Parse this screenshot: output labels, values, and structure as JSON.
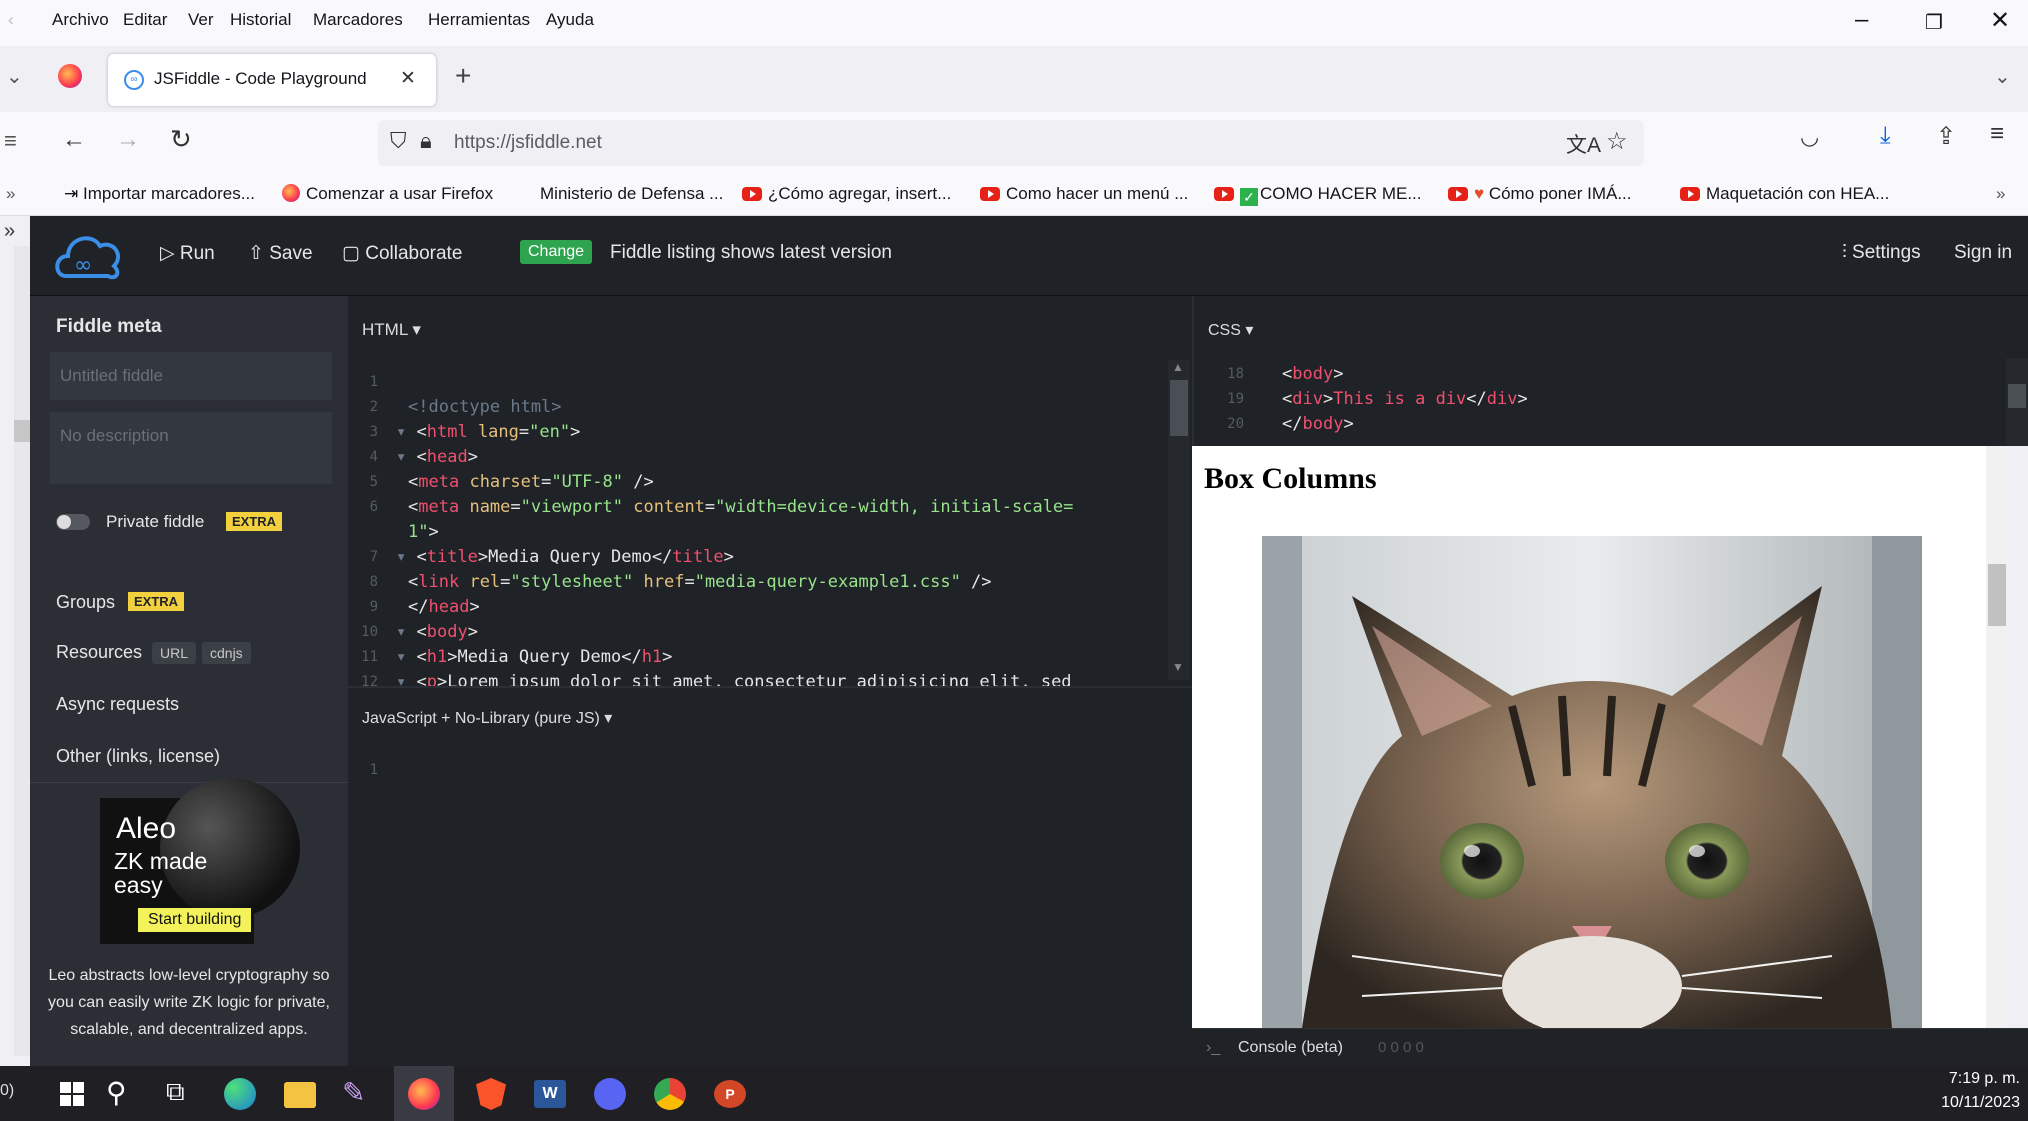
{
  "menubar": {
    "items": [
      "Archivo",
      "Editar",
      "Ver",
      "Historial",
      "Marcadores",
      "Herramientas",
      "Ayuda"
    ]
  },
  "tabs": [
    {
      "label": "JSFiddle - Code Playground"
    }
  ],
  "nav": {
    "url": "https://jsfiddle.net"
  },
  "bookmarks": [
    {
      "label": "Importar marcadores...",
      "icon": "import-icon"
    },
    {
      "label": "Comenzar a usar Firefox",
      "icon": "firefox-icon"
    },
    {
      "label": "Ministerio de Defensa ...",
      "icon": "blank"
    },
    {
      "label": "¿Cómo agregar, insert...",
      "icon": "youtube-icon"
    },
    {
      "label": "Como hacer un menú ...",
      "icon": "youtube-icon"
    },
    {
      "label": "COMO HACER ME...",
      "icon": "youtube-icon"
    },
    {
      "label": "Cómo poner IMÁ...",
      "icon": "youtube-icon"
    },
    {
      "label": "Maquetación con HEA...",
      "icon": "youtube-icon"
    }
  ],
  "jsfiddle": {
    "run": "Run",
    "save": "Save",
    "collaborate": "Collaborate",
    "change_badge": "Change",
    "notice": "Fiddle listing shows latest version",
    "settings": "Settings",
    "signin": "Sign in"
  },
  "meta": {
    "title": "Fiddle meta",
    "name_placeholder": "Untitled fiddle",
    "desc_placeholder": "No description",
    "private": "Private fiddle",
    "extra": "EXTRA",
    "groups": "Groups",
    "resources": "Resources",
    "url_pill": "URL",
    "cdnjs_pill": "cdnjs",
    "async": "Async requests",
    "other": "Other (links, license)",
    "ad": {
      "brand": "Aleo",
      "line1": "ZK made",
      "line2": "easy",
      "button": "Start building",
      "text": "Leo abstracts low-level cryptography so you can easily write ZK logic for private, scalable, and decentralized apps."
    }
  },
  "panels": {
    "html_label": "HTML ▾",
    "js_label": "JavaScript + No-Library (pure JS) ▾",
    "css_label": "CSS ▾",
    "console_label": "Console (beta)",
    "console_counts": "0  0  0  0"
  },
  "result": {
    "heading": "Box Columns"
  },
  "taskbar": {
    "time": "7:19 p. m.",
    "date": "10/11/2023"
  }
}
